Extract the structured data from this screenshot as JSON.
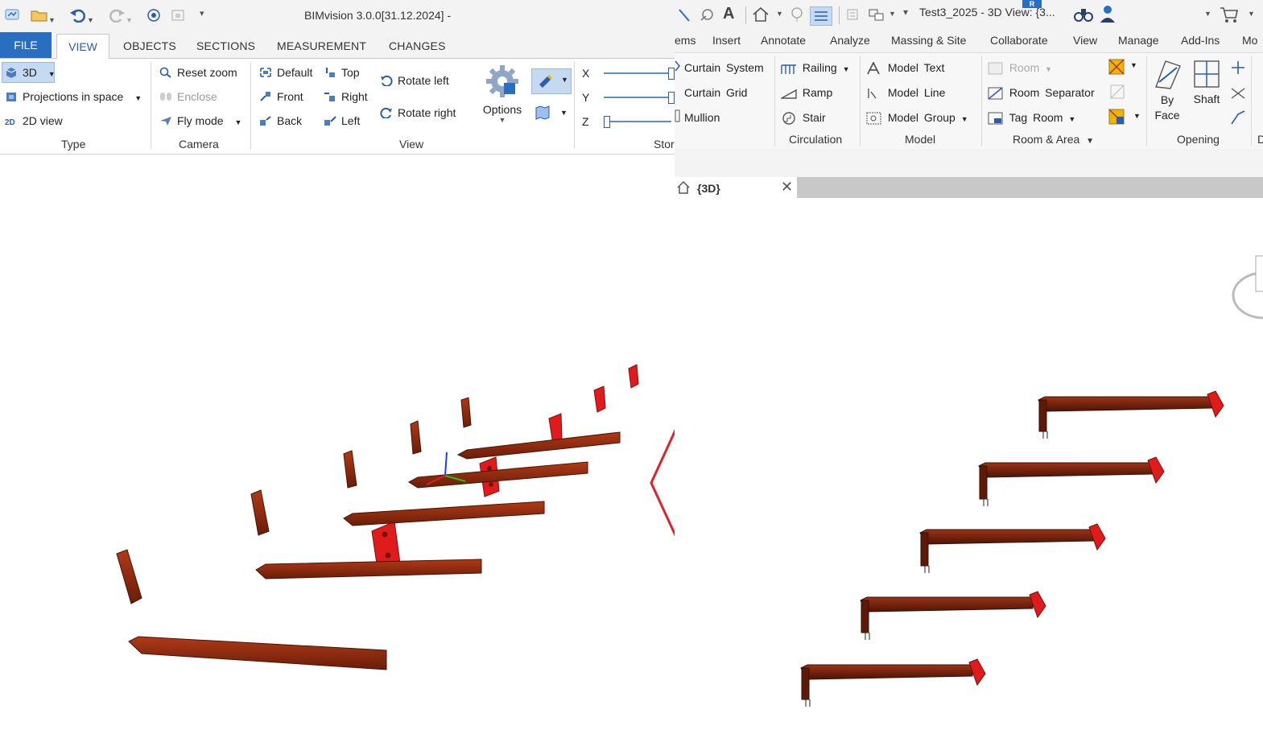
{
  "bimvision": {
    "title": "BIMvision 3.0.0[31.12.2024] -",
    "tabs": [
      "FILE",
      "VIEW",
      "OBJECTS",
      "SECTIONS",
      "MEASUREMENT",
      "CHANGES"
    ],
    "type_group": {
      "label": "Type",
      "items": [
        "3D",
        "Projections in space",
        "2D view"
      ],
      "icon_text_2d": "2D"
    },
    "camera_group": {
      "label": "Camera",
      "items": [
        "Reset zoom",
        "Enclose",
        "Fly mode"
      ]
    },
    "view_group": {
      "label": "View",
      "items": [
        "Default",
        "Top",
        "Front",
        "Right",
        "Back",
        "Left",
        "Rotate left",
        "Rotate right",
        "Options"
      ]
    },
    "storey_group": {
      "label": "Stor",
      "axes": [
        "X",
        "Y",
        "Z"
      ]
    }
  },
  "revit": {
    "title": "Test3_2025 - 3D View: {3...",
    "badge": "R",
    "menu": [
      "ems",
      "Insert",
      "Annotate",
      "Analyze",
      "Massing & Site",
      "Collaborate",
      "View",
      "Manage",
      "Add-Ins",
      "Mo"
    ],
    "build_items": [
      "Curtain System",
      "Curtain Grid",
      "Mullion"
    ],
    "circulation": {
      "label": "Circulation",
      "items": [
        "Railing",
        "Ramp",
        "Stair"
      ]
    },
    "model": {
      "label": "Model",
      "items": [
        "Model Text",
        "Model Line",
        "Model Group"
      ]
    },
    "room_area": {
      "label": "Room & Area",
      "items": [
        "Room",
        "Room Separator",
        "Tag Room"
      ]
    },
    "opening": {
      "label": "Opening",
      "items": [
        "By Face",
        "Shaft"
      ],
      "items_split": [
        "By",
        "Face"
      ]
    },
    "partial_group": "D",
    "view_tab": "{3D}"
  },
  "colors": {
    "beam": "#8b2a12",
    "beam_dark": "#5e1a08",
    "plate": "#e01b1b",
    "arrow": "#e0202a",
    "accent": "#2a6ec2"
  }
}
